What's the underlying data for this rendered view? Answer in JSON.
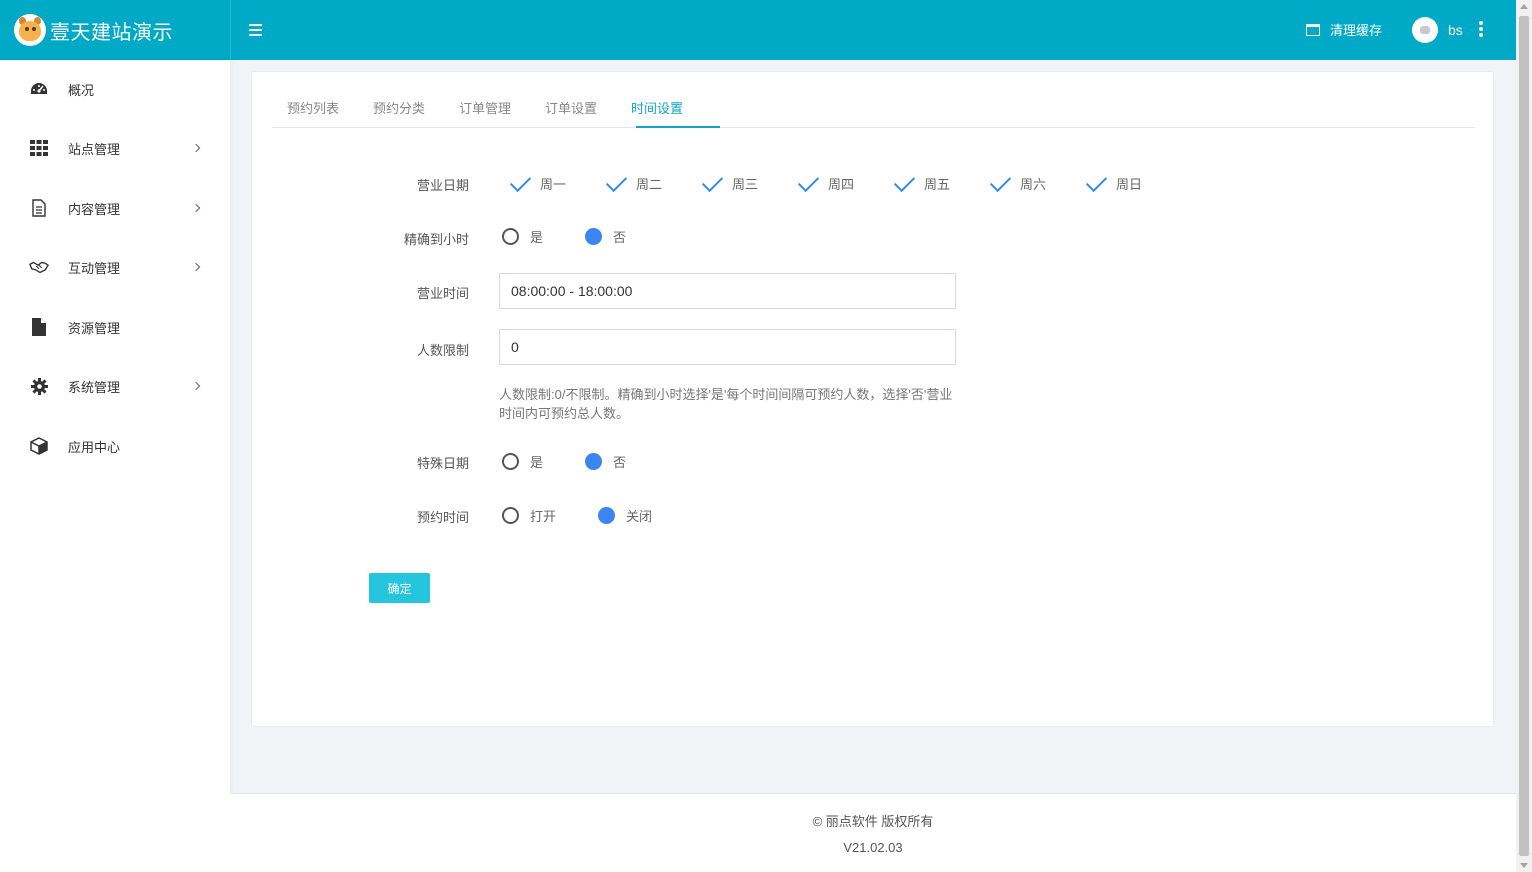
{
  "brand": {
    "title": "壹天建站演示"
  },
  "header": {
    "clear_cache": "清理缓存",
    "user_name": "bs"
  },
  "sidebar": {
    "items": [
      {
        "label": "概况",
        "icon": "dashboard-icon",
        "has_arrow": false
      },
      {
        "label": "站点管理",
        "icon": "grid-icon",
        "has_arrow": true
      },
      {
        "label": "内容管理",
        "icon": "document-icon",
        "has_arrow": true
      },
      {
        "label": "互动管理",
        "icon": "handshake-icon",
        "has_arrow": true
      },
      {
        "label": "资源管理",
        "icon": "file-icon",
        "has_arrow": false
      },
      {
        "label": "系统管理",
        "icon": "gear-icon",
        "has_arrow": true
      },
      {
        "label": "应用中心",
        "icon": "cube-icon",
        "has_arrow": false
      }
    ]
  },
  "tabs": [
    {
      "label": "预约列表",
      "active": false
    },
    {
      "label": "预约分类",
      "active": false
    },
    {
      "label": "订单管理",
      "active": false
    },
    {
      "label": "订单设置",
      "active": false
    },
    {
      "label": "时间设置",
      "active": true
    }
  ],
  "form": {
    "business_days": {
      "label": "营业日期",
      "days": [
        "周一",
        "周二",
        "周三",
        "周四",
        "周五",
        "周六",
        "周日"
      ],
      "checked": [
        true,
        true,
        true,
        true,
        true,
        true,
        true
      ]
    },
    "hour_precision": {
      "label": "精确到小时",
      "options": [
        "是",
        "否"
      ],
      "selected": "否"
    },
    "business_hours": {
      "label": "营业时间",
      "value": "08:00:00 - 18:00:00"
    },
    "people_limit": {
      "label": "人数限制",
      "value": "0",
      "help": "人数限制:0/不限制。精确到小时选择'是'每个时间间隔可预约人数，选择'否'营业时间内可预约总人数。"
    },
    "special_date": {
      "label": "特殊日期",
      "options": [
        "是",
        "否"
      ],
      "selected": "否"
    },
    "booking_time": {
      "label": "预约时间",
      "options": [
        "打开",
        "关闭"
      ],
      "selected": "关闭"
    },
    "submit_label": "确定"
  },
  "footer": {
    "copyright": "© 丽点软件 版权所有",
    "version": "V21.02.03"
  },
  "colors": {
    "topbar": "#00a9c5",
    "accent": "#13a6c3",
    "button": "#25c5dd",
    "check": "#2d8cf0",
    "radio_on": "#3b85f0"
  }
}
